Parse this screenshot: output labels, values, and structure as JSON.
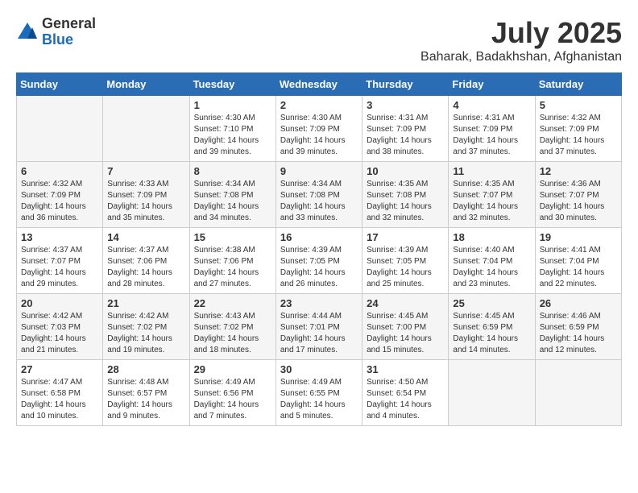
{
  "header": {
    "logo_general": "General",
    "logo_blue": "Blue",
    "month_title": "July 2025",
    "location": "Baharak, Badakhshan, Afghanistan"
  },
  "days_of_week": [
    "Sunday",
    "Monday",
    "Tuesday",
    "Wednesday",
    "Thursday",
    "Friday",
    "Saturday"
  ],
  "weeks": [
    [
      {
        "day": "",
        "info": ""
      },
      {
        "day": "",
        "info": ""
      },
      {
        "day": "1",
        "info": "Sunrise: 4:30 AM\nSunset: 7:10 PM\nDaylight: 14 hours and 39 minutes."
      },
      {
        "day": "2",
        "info": "Sunrise: 4:30 AM\nSunset: 7:09 PM\nDaylight: 14 hours and 39 minutes."
      },
      {
        "day": "3",
        "info": "Sunrise: 4:31 AM\nSunset: 7:09 PM\nDaylight: 14 hours and 38 minutes."
      },
      {
        "day": "4",
        "info": "Sunrise: 4:31 AM\nSunset: 7:09 PM\nDaylight: 14 hours and 37 minutes."
      },
      {
        "day": "5",
        "info": "Sunrise: 4:32 AM\nSunset: 7:09 PM\nDaylight: 14 hours and 37 minutes."
      }
    ],
    [
      {
        "day": "6",
        "info": "Sunrise: 4:32 AM\nSunset: 7:09 PM\nDaylight: 14 hours and 36 minutes."
      },
      {
        "day": "7",
        "info": "Sunrise: 4:33 AM\nSunset: 7:09 PM\nDaylight: 14 hours and 35 minutes."
      },
      {
        "day": "8",
        "info": "Sunrise: 4:34 AM\nSunset: 7:08 PM\nDaylight: 14 hours and 34 minutes."
      },
      {
        "day": "9",
        "info": "Sunrise: 4:34 AM\nSunset: 7:08 PM\nDaylight: 14 hours and 33 minutes."
      },
      {
        "day": "10",
        "info": "Sunrise: 4:35 AM\nSunset: 7:08 PM\nDaylight: 14 hours and 32 minutes."
      },
      {
        "day": "11",
        "info": "Sunrise: 4:35 AM\nSunset: 7:07 PM\nDaylight: 14 hours and 32 minutes."
      },
      {
        "day": "12",
        "info": "Sunrise: 4:36 AM\nSunset: 7:07 PM\nDaylight: 14 hours and 30 minutes."
      }
    ],
    [
      {
        "day": "13",
        "info": "Sunrise: 4:37 AM\nSunset: 7:07 PM\nDaylight: 14 hours and 29 minutes."
      },
      {
        "day": "14",
        "info": "Sunrise: 4:37 AM\nSunset: 7:06 PM\nDaylight: 14 hours and 28 minutes."
      },
      {
        "day": "15",
        "info": "Sunrise: 4:38 AM\nSunset: 7:06 PM\nDaylight: 14 hours and 27 minutes."
      },
      {
        "day": "16",
        "info": "Sunrise: 4:39 AM\nSunset: 7:05 PM\nDaylight: 14 hours and 26 minutes."
      },
      {
        "day": "17",
        "info": "Sunrise: 4:39 AM\nSunset: 7:05 PM\nDaylight: 14 hours and 25 minutes."
      },
      {
        "day": "18",
        "info": "Sunrise: 4:40 AM\nSunset: 7:04 PM\nDaylight: 14 hours and 23 minutes."
      },
      {
        "day": "19",
        "info": "Sunrise: 4:41 AM\nSunset: 7:04 PM\nDaylight: 14 hours and 22 minutes."
      }
    ],
    [
      {
        "day": "20",
        "info": "Sunrise: 4:42 AM\nSunset: 7:03 PM\nDaylight: 14 hours and 21 minutes."
      },
      {
        "day": "21",
        "info": "Sunrise: 4:42 AM\nSunset: 7:02 PM\nDaylight: 14 hours and 19 minutes."
      },
      {
        "day": "22",
        "info": "Sunrise: 4:43 AM\nSunset: 7:02 PM\nDaylight: 14 hours and 18 minutes."
      },
      {
        "day": "23",
        "info": "Sunrise: 4:44 AM\nSunset: 7:01 PM\nDaylight: 14 hours and 17 minutes."
      },
      {
        "day": "24",
        "info": "Sunrise: 4:45 AM\nSunset: 7:00 PM\nDaylight: 14 hours and 15 minutes."
      },
      {
        "day": "25",
        "info": "Sunrise: 4:45 AM\nSunset: 6:59 PM\nDaylight: 14 hours and 14 minutes."
      },
      {
        "day": "26",
        "info": "Sunrise: 4:46 AM\nSunset: 6:59 PM\nDaylight: 14 hours and 12 minutes."
      }
    ],
    [
      {
        "day": "27",
        "info": "Sunrise: 4:47 AM\nSunset: 6:58 PM\nDaylight: 14 hours and 10 minutes."
      },
      {
        "day": "28",
        "info": "Sunrise: 4:48 AM\nSunset: 6:57 PM\nDaylight: 14 hours and 9 minutes."
      },
      {
        "day": "29",
        "info": "Sunrise: 4:49 AM\nSunset: 6:56 PM\nDaylight: 14 hours and 7 minutes."
      },
      {
        "day": "30",
        "info": "Sunrise: 4:49 AM\nSunset: 6:55 PM\nDaylight: 14 hours and 5 minutes."
      },
      {
        "day": "31",
        "info": "Sunrise: 4:50 AM\nSunset: 6:54 PM\nDaylight: 14 hours and 4 minutes."
      },
      {
        "day": "",
        "info": ""
      },
      {
        "day": "",
        "info": ""
      }
    ]
  ]
}
